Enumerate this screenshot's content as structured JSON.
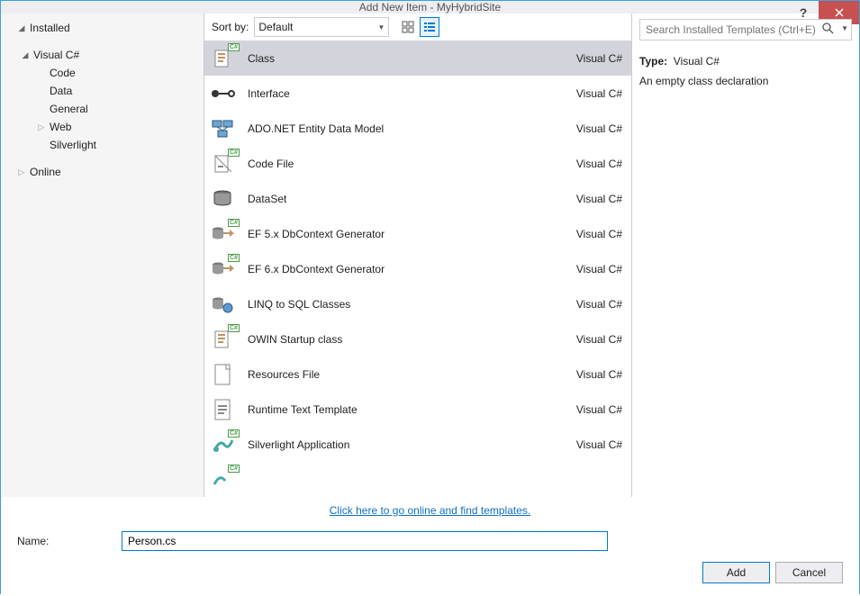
{
  "title": "Add New Item - MyHybridSite",
  "tree": {
    "installed": "Installed",
    "csharp": "Visual C#",
    "code": "Code",
    "data": "Data",
    "general": "General",
    "web": "Web",
    "silverlight": "Silverlight",
    "online": "Online"
  },
  "sort": {
    "label": "Sort by:",
    "value": "Default"
  },
  "templates": [
    {
      "name": "Class",
      "lang": "Visual C#",
      "selected": true,
      "icon": "class"
    },
    {
      "name": "Interface",
      "lang": "Visual C#",
      "icon": "interface"
    },
    {
      "name": "ADO.NET Entity Data Model",
      "lang": "Visual C#",
      "icon": "ado"
    },
    {
      "name": "Code File",
      "lang": "Visual C#",
      "icon": "codefile"
    },
    {
      "name": "DataSet",
      "lang": "Visual C#",
      "icon": "dataset"
    },
    {
      "name": "EF 5.x DbContext Generator",
      "lang": "Visual C#",
      "icon": "ef"
    },
    {
      "name": "EF 6.x DbContext Generator",
      "lang": "Visual C#",
      "icon": "ef"
    },
    {
      "name": "LINQ to SQL Classes",
      "lang": "Visual C#",
      "icon": "linq"
    },
    {
      "name": "OWIN Startup class",
      "lang": "Visual C#",
      "icon": "class"
    },
    {
      "name": "Resources File",
      "lang": "Visual C#",
      "icon": "resx"
    },
    {
      "name": "Runtime Text Template",
      "lang": "Visual C#",
      "icon": "tt"
    },
    {
      "name": "Silverlight Application",
      "lang": "Visual C#",
      "icon": "sl"
    },
    {
      "name": "",
      "lang": "",
      "icon": "partial"
    }
  ],
  "search": {
    "placeholder": "Search Installed Templates (Ctrl+E)"
  },
  "details": {
    "typeLabel": "Type:",
    "typeValue": "Visual C#",
    "desc": "An empty class declaration"
  },
  "onlineLink": "Click here to go online and find templates.",
  "nameLabel": "Name:",
  "nameValue": "Person.cs",
  "buttons": {
    "add": "Add",
    "cancel": "Cancel"
  }
}
